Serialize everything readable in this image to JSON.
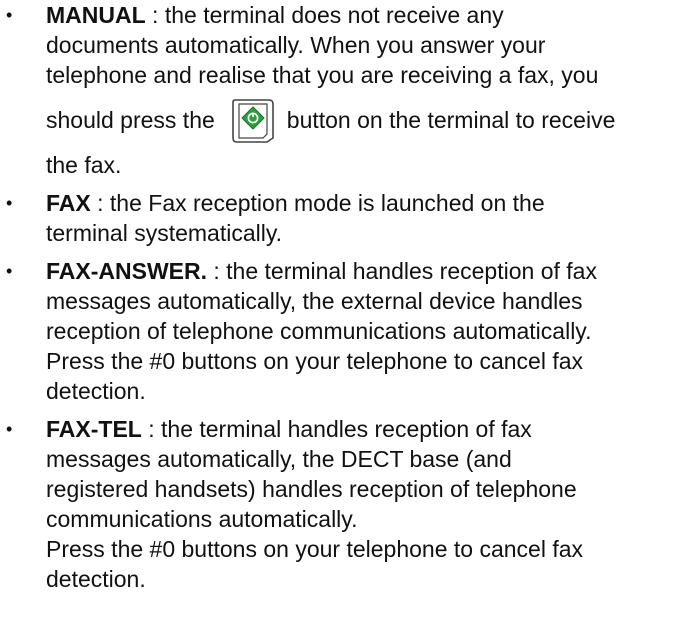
{
  "modes": [
    {
      "term": "MANUAL",
      "lines": [
        " : the terminal does not receive any",
        "documents automatically. When you answer your",
        "telephone and realise that you are receiving a fax, you"
      ],
      "before_button": "should press the",
      "after_button": "button on the terminal to receive",
      "last_line": "the fax.",
      "button_icon": "start-button-icon"
    },
    {
      "term": "FAX",
      "lines": [
        " : the Fax reception mode is launched on the",
        "terminal systematically."
      ]
    },
    {
      "term": "FAX-ANSWER.",
      "lines": [
        " : the terminal handles reception of fax",
        "messages automatically, the external device handles",
        "reception of telephone communications automatically.",
        "Press the #0 buttons on your telephone to cancel fax",
        "detection."
      ]
    },
    {
      "term": "FAX-TEL",
      "lines": [
        " : the terminal handles reception of fax",
        "messages automatically, the DECT base (and",
        "registered handsets) handles reception of telephone",
        "communications automatically.",
        "Press the #0 buttons on your telephone to cancel fax",
        "detection."
      ]
    }
  ],
  "bullet_glyph": "•",
  "colors": {
    "text": "#111111",
    "icon_green": "#2e9e3e",
    "icon_stroke": "#444444"
  }
}
